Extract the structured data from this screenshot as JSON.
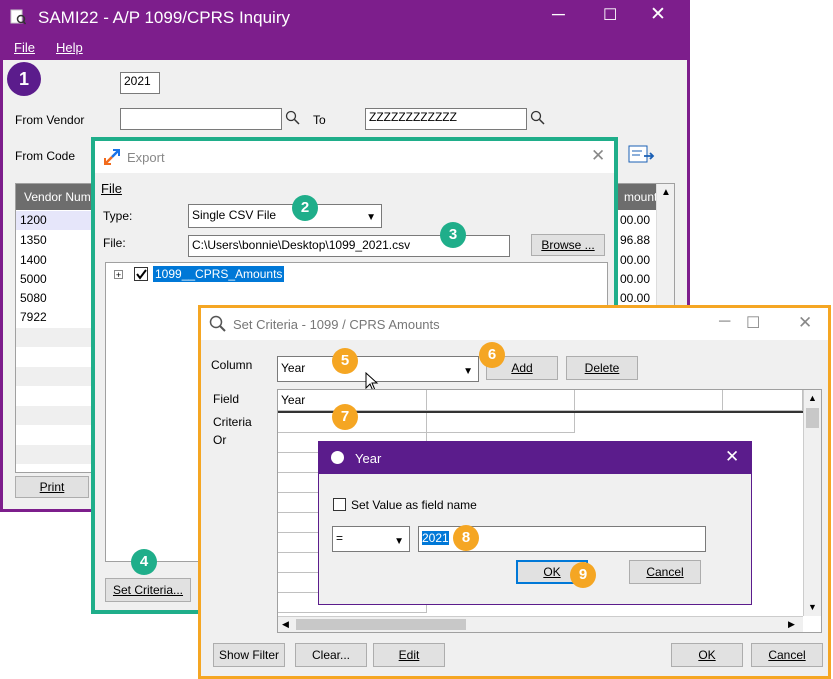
{
  "main_window": {
    "title": "SAMI22 - A/P 1099/CPRS Inquiry",
    "menu": [
      "File",
      "Help"
    ],
    "year": "2021",
    "from_vendor_label": "From Vendor",
    "from_vendor_value": "",
    "to_label": "To",
    "to_value": "ZZZZZZZZZZZZ",
    "from_code_label": "From Code",
    "grid_header_left": "Vendor Num",
    "grid_header_right": "mount",
    "vendors": [
      "1200",
      "1350",
      "1400",
      "5000",
      "5080",
      "7922"
    ],
    "amounts": [
      "00.00",
      "96.88",
      "00.00",
      "00.00",
      "00.00",
      ""
    ],
    "print_button": "Print"
  },
  "export_dialog": {
    "title": "Export",
    "menu_file": "File",
    "type_label": "Type:",
    "type_value": "Single CSV File",
    "file_label": "File:",
    "file_value": "C:\\Users\\bonnie\\Desktop\\1099_2021.csv",
    "browse_button": "Browse ...",
    "tree_item": "1099__CPRS_Amounts",
    "set_criteria_button": "Set Criteria..."
  },
  "criteria_dialog": {
    "title": "Set Criteria - 1099 / CPRS Amounts",
    "column_label": "Column",
    "column_value": "Year",
    "add_button": "Add",
    "delete_button": "Delete",
    "row_labels": [
      "Field",
      "Criteria",
      "Or"
    ],
    "grid_first_header": "Year",
    "show_filter_button": "Show Filter",
    "clear_button": "Clear...",
    "edit_button": "Edit",
    "ok_button": "OK",
    "cancel_button": "Cancel"
  },
  "year_dialog": {
    "title": "Year",
    "checkbox_label": "Set Value as field name",
    "operator": "=",
    "value": "2021",
    "ok_button": "OK",
    "cancel_button": "Cancel"
  },
  "badges": [
    "1",
    "2",
    "3",
    "4",
    "5",
    "6",
    "7",
    "8",
    "9"
  ],
  "colors": {
    "main_title_bar": "#7d1e8c",
    "export_border": "#1fae8a",
    "criteria_border": "#f5a623",
    "year_title_bar": "#5b1c8c",
    "selection": "#0078d7"
  }
}
